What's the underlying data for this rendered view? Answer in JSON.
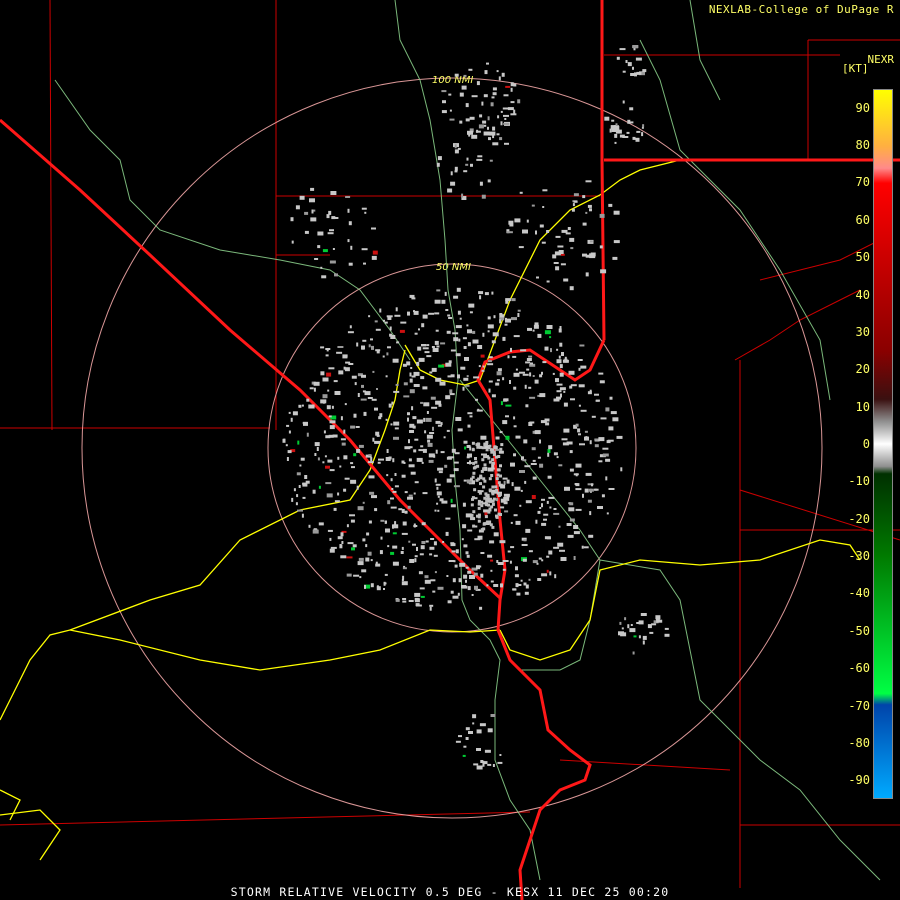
{
  "header": {
    "credit": "NEXLAB-College of DuPage R",
    "product": "NEXR",
    "units": "[KT]"
  },
  "rings": [
    {
      "label": "50 NMI",
      "radius_nmi": 50
    },
    {
      "label": "100 NMI",
      "radius_nmi": 100
    }
  ],
  "legend": {
    "ticks": [
      90,
      80,
      70,
      60,
      50,
      40,
      30,
      20,
      10,
      0,
      -10,
      -20,
      -30,
      -40,
      -50,
      -60,
      -70,
      -80,
      -90
    ],
    "min": -95,
    "max": 95,
    "color_stops": [
      {
        "value": 95,
        "color": "#ffff00"
      },
      {
        "value": 80,
        "color": "#ffb040"
      },
      {
        "value": 74,
        "color": "#ff8a8a"
      },
      {
        "value": 70,
        "color": "#ff0000"
      },
      {
        "value": 25,
        "color": "#8a0000"
      },
      {
        "value": 12,
        "color": "#3a1010"
      },
      {
        "value": 6,
        "color": "#909090"
      },
      {
        "value": 0,
        "color": "#ffffff"
      },
      {
        "value": -6,
        "color": "#909090"
      },
      {
        "value": -8,
        "color": "#003000"
      },
      {
        "value": -30,
        "color": "#007a00"
      },
      {
        "value": -67,
        "color": "#00ff44"
      },
      {
        "value": -70,
        "color": "#0044aa"
      },
      {
        "value": -95,
        "color": "#00aaff"
      }
    ]
  },
  "colors": {
    "state_border": "#ff2020",
    "county_line": "#cc0000",
    "highway": "#ffff00",
    "road": "#88cc88",
    "range_ring": "#ffb0b0",
    "echo_gray": "#c8c8c8"
  },
  "caption": "STORM RELATIVE VELOCITY 0.5 DEG - KESX 11 DEC 25 00:20"
}
